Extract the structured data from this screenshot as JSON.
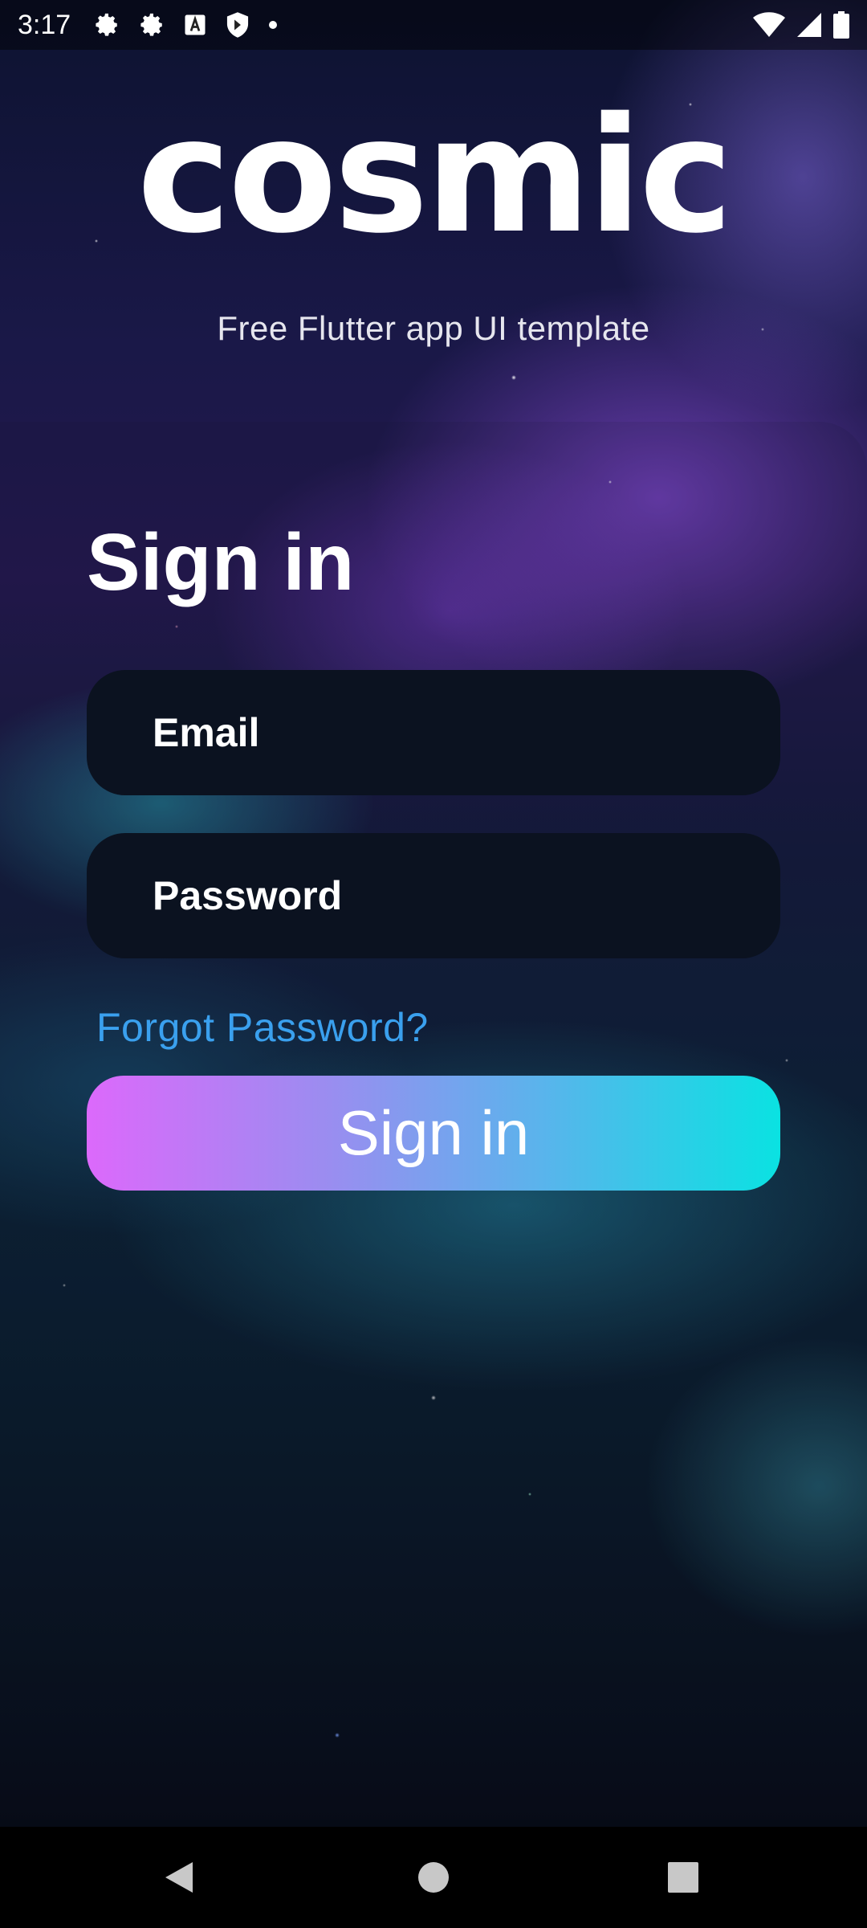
{
  "status_bar": {
    "time": "3:17",
    "left_icons": [
      "settings-gear-icon",
      "settings-gear-icon",
      "keyboard-a-icon",
      "shield-icon",
      "notification-dot-icon"
    ],
    "right_icons": [
      "wifi-icon",
      "cell-signal-icon",
      "battery-icon"
    ]
  },
  "logo": {
    "text": "cosmic",
    "tagline": "Free Flutter app UI template"
  },
  "signin_form": {
    "title": "Sign in",
    "email_placeholder": "Email",
    "password_placeholder": "Password",
    "forgot_password": "Forgot Password?",
    "submit_label": "Sign in"
  },
  "colors": {
    "field_bg": "#0b1220",
    "link": "#3aa0ee",
    "button_gradient_start": "#dc69fb",
    "button_gradient_end": "#0ae2e2"
  },
  "nav_bar": {
    "icons": [
      "back-icon",
      "home-icon",
      "recents-icon"
    ]
  }
}
